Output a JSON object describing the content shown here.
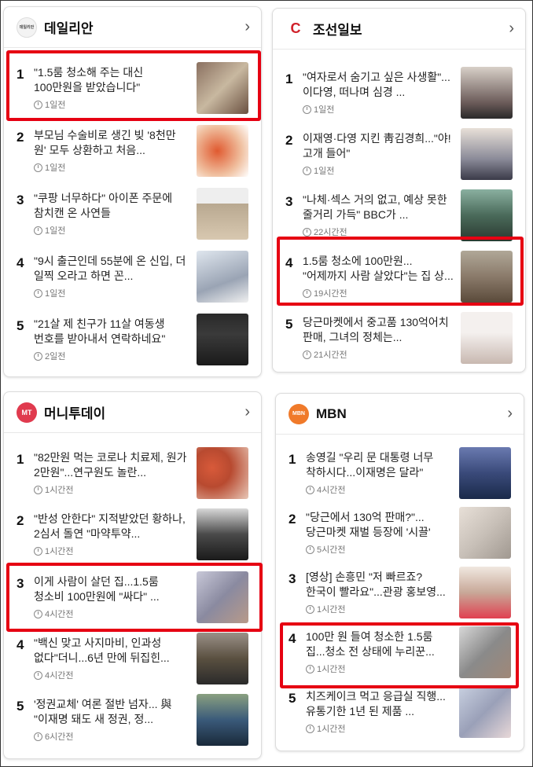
{
  "cards": [
    {
      "press": "데일리안",
      "logo_text": "데일리안",
      "logo_color": "#f3f3f3",
      "items": [
        {
          "rank": "1",
          "title": "\"1.5룸 청소해 주는 대신 100만원을 받았습니다\"",
          "time": "1일전"
        },
        {
          "rank": "2",
          "title": "부모님 수술비로 생긴 빚 '8천만 원' 모두 상환하고 처음...",
          "time": "1일전"
        },
        {
          "rank": "3",
          "title": "\"쿠팡 너무하다\" 아이폰 주문에 참치캔 온 사연들",
          "time": "1일전"
        },
        {
          "rank": "4",
          "title": "\"9시 출근인데 55분에 온 신입, 더 일찍 오라고 하면 꼰...",
          "time": "1일전"
        },
        {
          "rank": "5",
          "title": "\"21살 제 친구가 11살 여동생 번호를 받아내서 연락하네요\"",
          "time": "2일전"
        }
      ]
    },
    {
      "press": "조선일보",
      "logo_text": "C",
      "logo_color": "#ffffff",
      "items": [
        {
          "rank": "1",
          "title": "\"여자로서 숨기고 싶은 사생활\"... 이다영, 떠나며 심경 ...",
          "time": "1일전"
        },
        {
          "rank": "2",
          "title": "이재영·다영 지킨 靑김경희...\"야! 고개 들어\"",
          "time": "1일전"
        },
        {
          "rank": "3",
          "title": "\"나체·섹스 거의 없고, 예상 못한 줄거리 가득\" BBC가 ...",
          "time": "22시간전"
        },
        {
          "rank": "4",
          "title": "1.5룸 청소에 100만원... \"어제까지 사람 살았다\"는 집 상...",
          "time": "19시간전"
        },
        {
          "rank": "5",
          "title": "당근마켓에서 중고품 130억어치 판매, 그녀의 정체는...",
          "time": "21시간전"
        }
      ]
    },
    {
      "press": "머니투데이",
      "logo_text": "MT",
      "logo_color": "#e03a4e",
      "items": [
        {
          "rank": "1",
          "title": "\"82만원 먹는 코로나 치료제, 원가 2만원\"...연구원도 놀란...",
          "time": "1시간전"
        },
        {
          "rank": "2",
          "title": "\"반성 안한다\" 지적받았던 황하나, 2심서 돌연 \"마약투약...",
          "time": "1시간전"
        },
        {
          "rank": "3",
          "title": "이게 사람이 살던 집...1.5룸 청소비 100만원에 \"싸다\" ...",
          "time": "4시간전"
        },
        {
          "rank": "4",
          "title": "\"백신 맞고 사지마비, 인과성 없다\"더니...6년 만에 뒤집힌...",
          "time": "4시간전"
        },
        {
          "rank": "5",
          "title": "'정권교체' 여론 절반 넘자... 與 \"이재명 돼도 새 정권, 정...",
          "time": "6시간전"
        }
      ]
    },
    {
      "press": "MBN",
      "logo_text": "MBN",
      "logo_color": "#f07a2a",
      "items": [
        {
          "rank": "1",
          "title": "송영길 \"우리 문 대통령 너무 착하시다...이재명은 달라\"",
          "time": "4시간전"
        },
        {
          "rank": "2",
          "title": "\"당근에서 130억 판매?\"...당근마켓 재벌 등장에 '시끌'",
          "time": "5시간전"
        },
        {
          "rank": "3",
          "title": "[영상] 손흥민 \"저 빠르죠? 한국이 빨라요\"...관광 홍보영...",
          "time": "1시간전"
        },
        {
          "rank": "4",
          "title": "100만 원 들여 청소한 1.5룸 집...청소 전 상태에 누리꾼...",
          "time": "1시간전"
        },
        {
          "rank": "5",
          "title": "치즈케이크 먹고 응급실 직행...유통기한 1년 된 제품 ...",
          "time": "1시간전"
        }
      ]
    }
  ],
  "thumb_colors": [
    [
      "#8a7060",
      "#c24a2a",
      "#b8a890",
      "#9aa4b4",
      "#3a3a3a"
    ],
    [
      "#6a5a58",
      "#8a8a98",
      "#4a6a5a",
      "#8a7a6a",
      "#c8b8b0"
    ],
    [
      "#b84a30",
      "#4a4a4a",
      "#8a8aa0",
      "#5a5040",
      "#3a5a7a"
    ],
    [
      "#3a4a7a",
      "#c8c0b8",
      "#c8a898",
      "#8a8a8a",
      "#9aa0b8"
    ]
  ]
}
